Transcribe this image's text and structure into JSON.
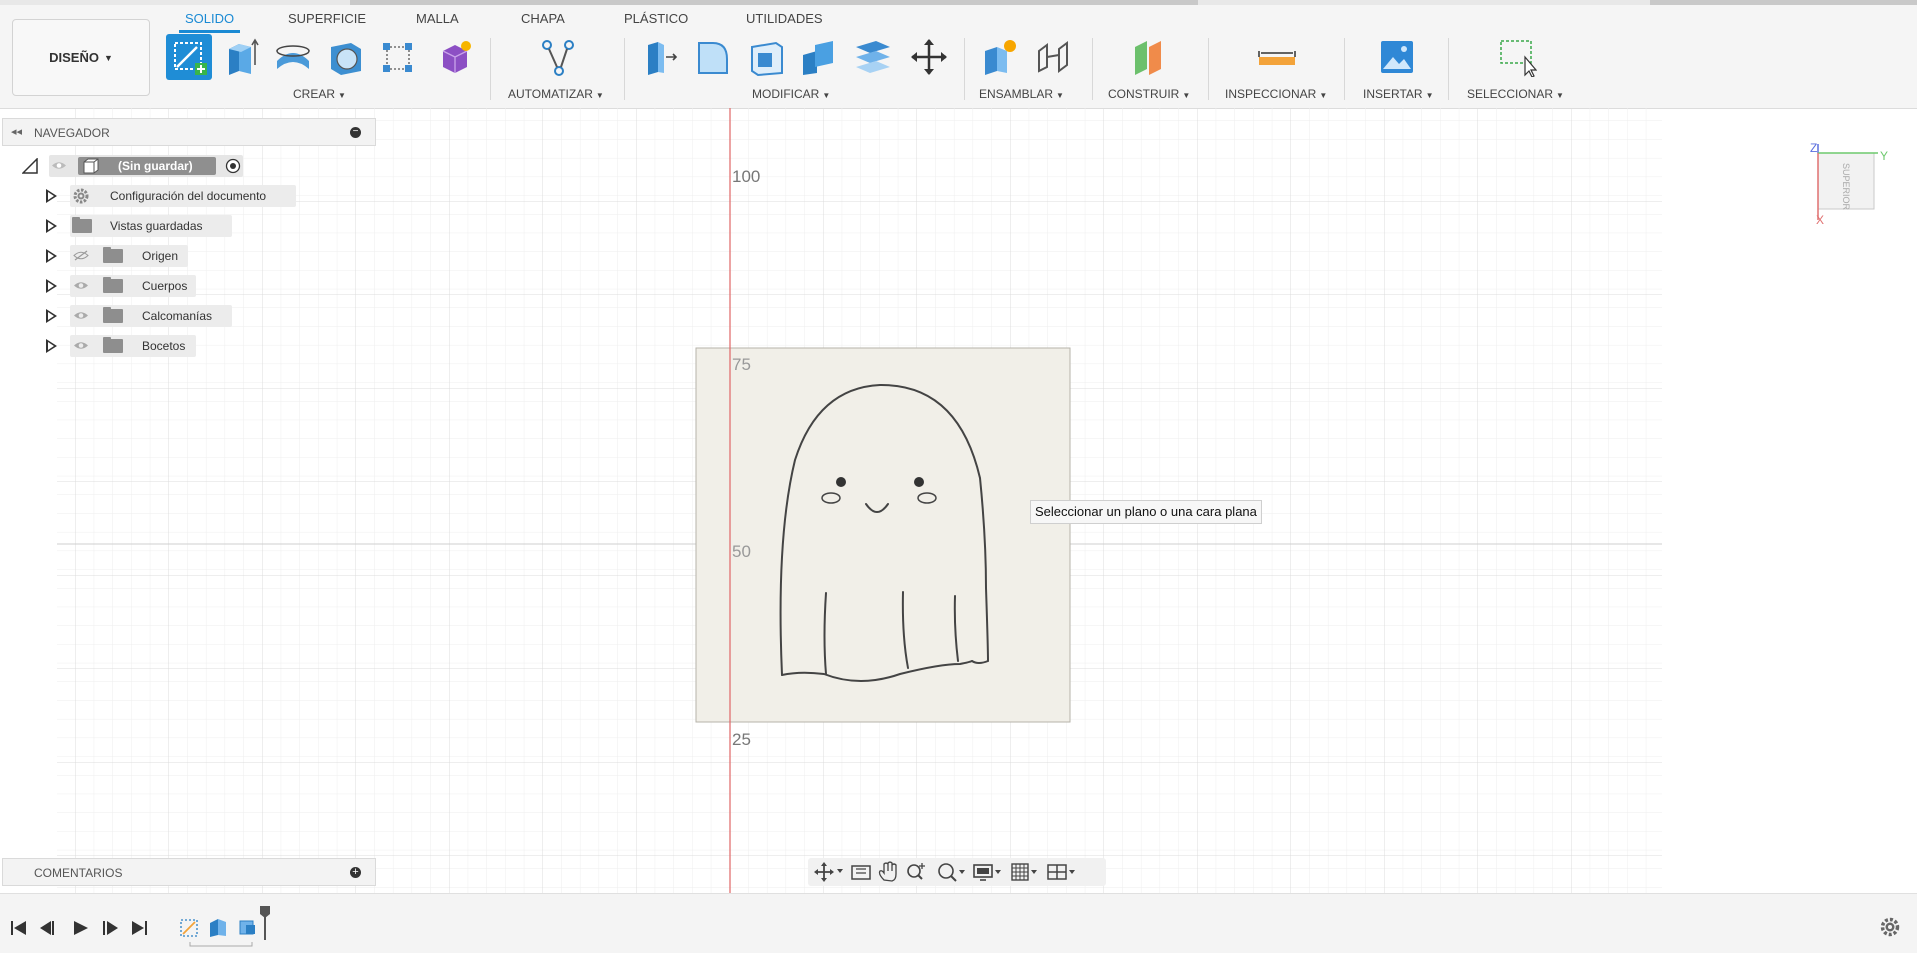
{
  "toolbar": {
    "design_button": "DISEÑO",
    "tabs": [
      "SOLIDO",
      "SUPERFICIE",
      "MALLA",
      "CHAPA",
      "PLÁSTICO",
      "UTILIDADES"
    ],
    "active_tab": "SOLIDO",
    "groups": {
      "create": "CREAR",
      "automate": "AUTOMATIZAR",
      "modify": "MODIFICAR",
      "assemble": "ENSAMBLAR",
      "construct": "CONSTRUIR",
      "inspect": "INSPECCIONAR",
      "insert": "INSERTAR",
      "select": "SELECCIONAR"
    }
  },
  "navigator": {
    "title": "NAVEGADOR",
    "root_label": "(Sin guardar)",
    "items": [
      {
        "label": "Configuración del documento",
        "icon": "gear-icon"
      },
      {
        "label": "Vistas guardadas",
        "icon": "folder-icon"
      },
      {
        "label": "Origen",
        "icon": "folder-icon"
      },
      {
        "label": "Cuerpos",
        "icon": "folder-icon"
      },
      {
        "label": "Calcomanías",
        "icon": "folder-icon"
      },
      {
        "label": "Bocetos",
        "icon": "folder-icon"
      }
    ]
  },
  "comments": {
    "title": "COMENTARIOS"
  },
  "canvas": {
    "tooltip": "Seleccionar un plano o una cara plana",
    "axis_labels": [
      "100",
      "75",
      "50",
      "25"
    ],
    "viewcube_face": "SUPERIOR",
    "viewcube_axes": [
      "Z",
      "Y",
      "X"
    ]
  },
  "colors": {
    "accent": "#1a8ad4",
    "axis_red": "#e06666",
    "grid": "#e4e4e4"
  }
}
